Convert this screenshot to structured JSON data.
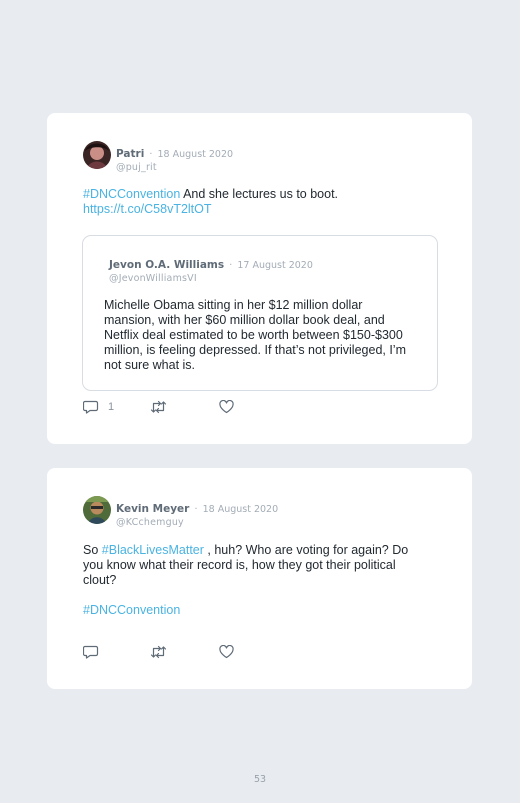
{
  "tweets": [
    {
      "author": "Patri",
      "date": "18 August 2020",
      "handle": "@puj_rit",
      "text_parts": {
        "hashtag": "#DNCConvention",
        "rest": "And she lectures us to boot.",
        "url": "https://t.co/C58vT2ltOT"
      },
      "reply_count": "1",
      "quoted": {
        "author": "Jevon O.A. Williams",
        "date": "17 August 2020",
        "handle": "@JevonWilliamsVI",
        "text": "Michelle Obama sitting in her $12 million dollar mansion, with her $60 million dollar book deal, and Netflix deal estimated to be worth between $150-$300 million, is feeling depressed. If that’s not privileged, I’m not sure what is."
      }
    },
    {
      "author": "Kevin Meyer",
      "date": "18 August 2020",
      "handle": "@KCchemguy",
      "text_parts": {
        "prefix": "So",
        "hashtag": "#BlackLivesMatter",
        "rest": ", huh? Who are voting for again? Do you know what their record is, how they got their political clout?",
        "hashtag2": "#DNCConvention"
      }
    }
  ],
  "separator": "·",
  "page_number": "53",
  "colors": {
    "link": "#4ab3e2",
    "background": "#e8ecf1",
    "card": "#ffffff"
  },
  "icons": [
    "reply-icon",
    "retweet-icon",
    "like-icon"
  ]
}
